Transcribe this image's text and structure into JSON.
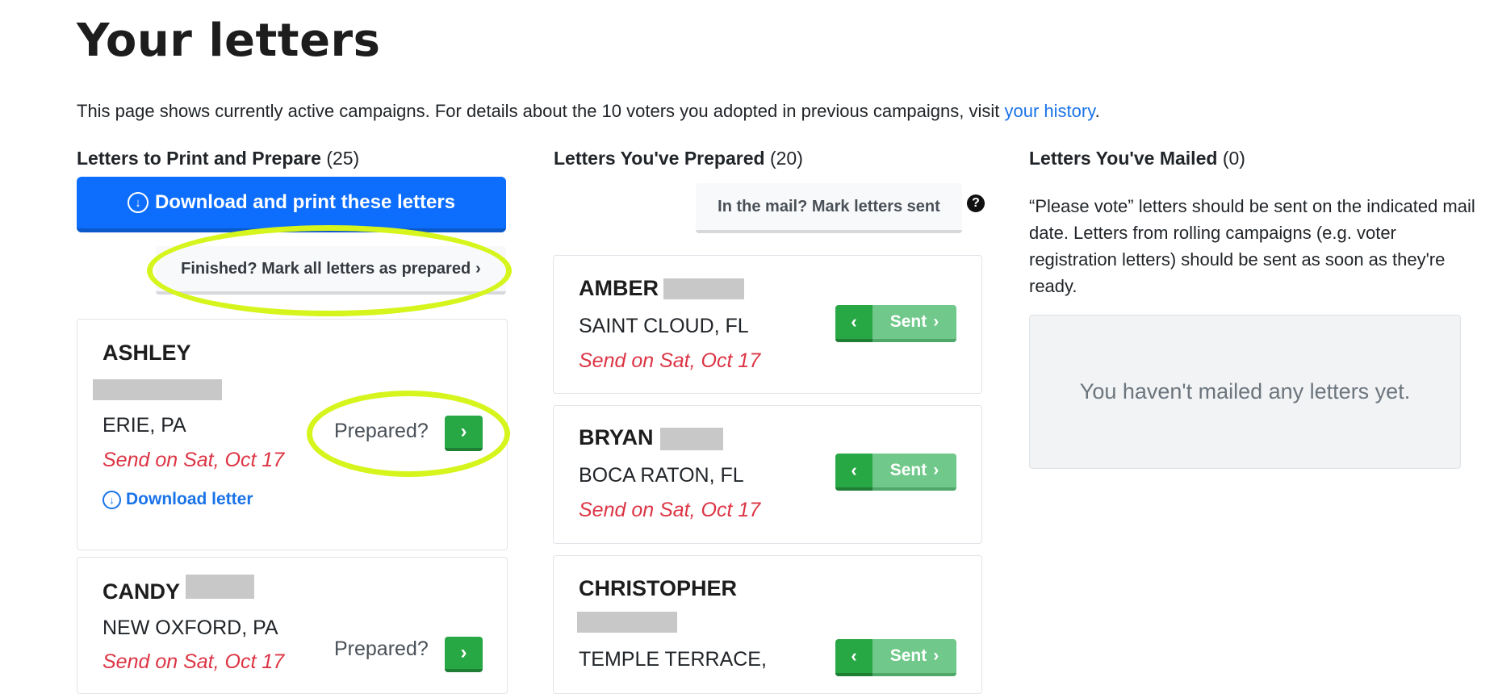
{
  "page": {
    "title": "Your letters",
    "intro_text": "This page shows currently active campaigns. For details about the 10 voters you adopted in previous campaigns, visit ",
    "intro_link": "your history",
    "intro_end": "."
  },
  "columns": {
    "to_prepare": {
      "heading": "Letters to Print and Prepare",
      "count": "(25)",
      "download_all_label": "Download and print these letters",
      "mark_all_label": "Finished? Mark all letters as prepared",
      "prepared_label": "Prepared?",
      "download_letter_label": "Download letter",
      "letters": [
        {
          "first_name": "ASHLEY",
          "city": "ERIE, PA",
          "send": "Send on Sat, Oct 17"
        },
        {
          "first_name": "CANDY",
          "city": "NEW OXFORD, PA",
          "send": "Send on Sat, Oct 17"
        }
      ]
    },
    "prepared": {
      "heading": "Letters You've Prepared",
      "count": "(20)",
      "mark_sent_label": "In the mail? Mark letters sent",
      "sent_label": "Sent",
      "letters": [
        {
          "first_name": "AMBER",
          "city": "SAINT CLOUD, FL",
          "send": "Send on Sat, Oct 17"
        },
        {
          "first_name": "BRYAN",
          "city": "BOCA RATON, FL",
          "send": "Send on Sat, Oct 17"
        },
        {
          "first_name": "CHRISTOPHER",
          "city": "TEMPLE TERRACE,"
        }
      ]
    },
    "mailed": {
      "heading": "Letters You've Mailed",
      "count": "(0)",
      "info_text": "“Please vote” letters should be sent on the indicated mail date. Letters from rolling campaigns (e.g. voter registration letters) should be sent as soon as they're ready.",
      "empty_text": "You haven't mailed any letters yet."
    }
  },
  "colors": {
    "primary": "#0d6efd",
    "success": "#28a745",
    "danger": "#dc3545",
    "highlight": "#d6f51c"
  },
  "icons": [
    "download-circle-icon",
    "chevron-right-icon",
    "chevron-left-icon",
    "question-circle-icon"
  ]
}
